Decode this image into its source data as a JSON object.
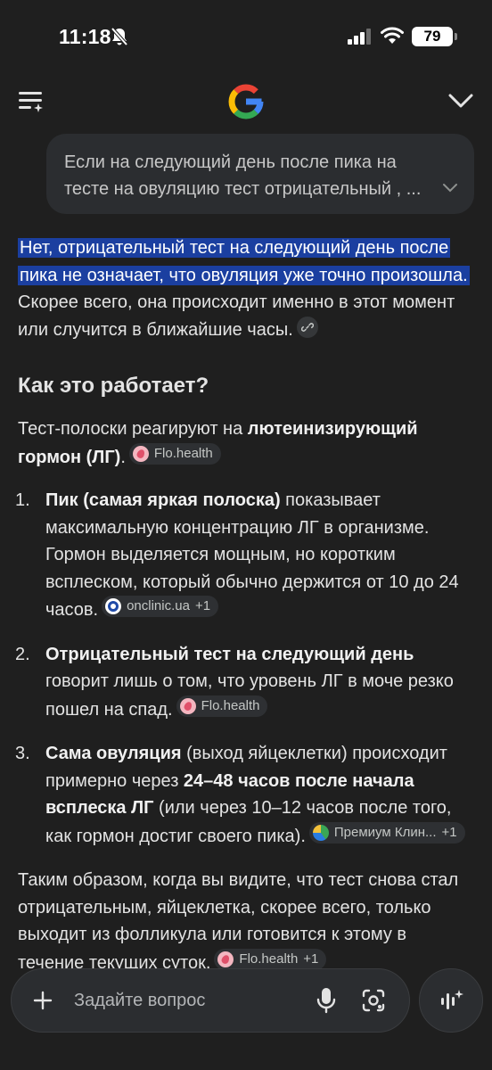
{
  "status_bar": {
    "time": "11:18",
    "battery": "79"
  },
  "query": {
    "text": "Если на следующий день после пика на тесте на овуляцию тест отрицательный , ..."
  },
  "answer": {
    "intro_highlight": "Нет, отрицательный тест на следующий день после пика не означает, что овуляция уже точно произошла.",
    "intro_rest": " Скорее всего, она происходит именно в этот момент или случится в ближайшие часы.",
    "heading": "Как это работает?",
    "para1_pre": "Тест-полоски реагируют на ",
    "para1_bold": "лютеинизирующий гормон (ЛГ)",
    "para1_post": ".",
    "list": [
      {
        "num": "1.",
        "bold": "Пик (самая яркая полоска)",
        "text": " показывает максимальную концентрацию ЛГ в организме. Гормон выделяется мощным, но коротким всплеском, который обычно держится от 10 до 24 часов.",
        "chip": {
          "label": "onclinic.ua",
          "extra": "+1"
        }
      },
      {
        "num": "2.",
        "bold": "Отрицательный тест на следующий день",
        "text": " говорит лишь о том, что уровень ЛГ в моче резко пошел на спад.",
        "chip": {
          "label": "Flo.health"
        }
      },
      {
        "num": "3.",
        "bold": "Сама овуляция",
        "text1": " (выход яйцеклетки) происходит примерно через ",
        "bold2": "24–48 часов после начала всплеска ЛГ",
        "text2": " (или через 10–12 часов после того, как гормон достиг своего пика).",
        "chip": {
          "label": "Премиум Клин...",
          "extra": "+1"
        }
      }
    ],
    "para1_chip": {
      "label": "Flo.health"
    },
    "final_text": "Таким образом, когда вы видите, что тест снова стал отрицательным, яйцеклетка, скорее всего, только выходит из фолликула или готовится к этому в течение текущих суток.",
    "final_chip": {
      "label": "Flo.health",
      "extra": "+1"
    }
  },
  "input": {
    "placeholder": "Задайте вопрос"
  },
  "icons": {
    "menu": "menu-sparkle-icon",
    "logo": "google-logo",
    "collapse": "chevron-down-icon",
    "link": "link-icon",
    "plus": "plus-icon",
    "mic": "mic-icon",
    "lens": "lens-icon",
    "live": "live-icon"
  },
  "colors": {
    "highlight": "#1b3fa0",
    "background": "#1f1f1f",
    "bubble": "#2b2d30"
  }
}
